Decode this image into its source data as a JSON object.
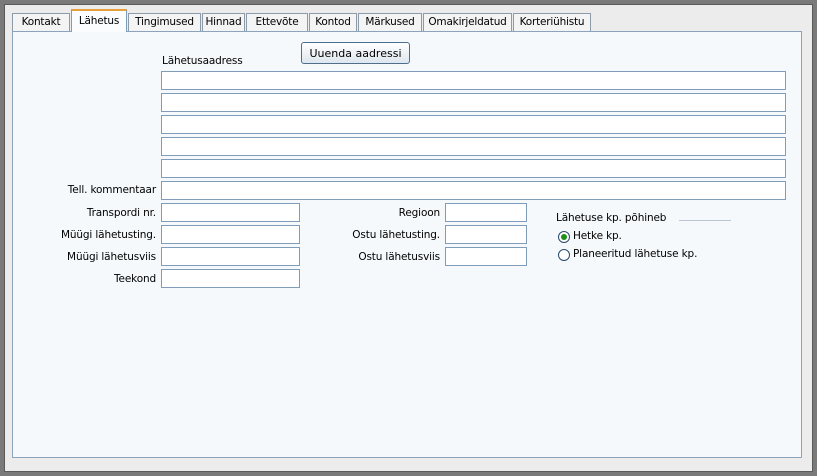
{
  "tabs": [
    {
      "label": "Kontakt"
    },
    {
      "label": "Lähetus"
    },
    {
      "label": "Tingimused"
    },
    {
      "label": "Hinnad"
    },
    {
      "label": "Ettevõte"
    },
    {
      "label": "Kontod"
    },
    {
      "label": "Märkused"
    },
    {
      "label": "Omakirjeldatud"
    },
    {
      "label": "Korteriühistu"
    }
  ],
  "active_tab": "Lähetus",
  "update_address_button": "Uuenda aadressi",
  "shipping_address": {
    "label": "Lähetusaadress",
    "lines": [
      "",
      "",
      "",
      "",
      ""
    ]
  },
  "order_comment": {
    "label": "Tell. kommentaar",
    "value": ""
  },
  "fields": {
    "transport_nr": {
      "label": "Transpordi nr.",
      "value": ""
    },
    "sales_shipping_terms": {
      "label": "Müügi lähetusting.",
      "value": ""
    },
    "sales_shipping_mode": {
      "label": "Müügi lähetusviis",
      "value": ""
    },
    "route": {
      "label": "Teekond",
      "value": ""
    },
    "region": {
      "label": "Regioon",
      "value": ""
    },
    "purchase_shipping_terms": {
      "label": "Ostu lähetusting.",
      "value": ""
    },
    "purchase_shipping_mode": {
      "label": "Ostu lähetusviis",
      "value": ""
    }
  },
  "shipping_date_basis": {
    "label": "Lähetuse kp. põhineb",
    "options": [
      {
        "label": "Hetke kp.",
        "selected": true
      },
      {
        "label": "Planeeritud lähetuse kp.",
        "selected": false
      }
    ]
  }
}
